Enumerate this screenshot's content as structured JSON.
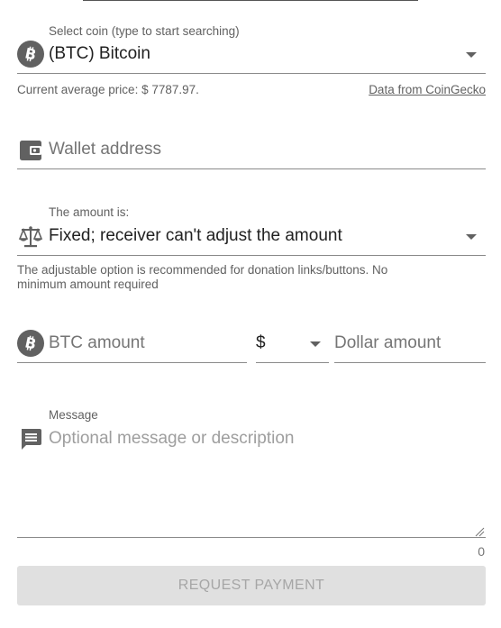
{
  "coin_select": {
    "label": "Select coin (type to start searching)",
    "value": "(BTC) Bitcoin",
    "icon": "bitcoin-icon"
  },
  "price_info": {
    "text": "Current average price: $ 7787.97.",
    "source_link": "Data from CoinGecko"
  },
  "wallet": {
    "placeholder": "Wallet address",
    "icon": "wallet-icon"
  },
  "amount_type": {
    "label": "The amount is:",
    "value": "Fixed; receiver can't adjust the amount",
    "icon": "scale-icon",
    "helper_line1": "The adjustable option is recommended for donation links/buttons. No",
    "helper_line2": "minimum amount required"
  },
  "amounts": {
    "coin_placeholder": "BTC amount",
    "coin_icon": "bitcoin-icon",
    "currency_value": "$",
    "fiat_placeholder": "Dollar amount"
  },
  "message": {
    "label": "Message",
    "placeholder": "Optional message or description",
    "icon": "message-icon",
    "char_count": "0"
  },
  "submit": {
    "label": "REQUEST PAYMENT"
  },
  "colors": {
    "icon_gray": "#616161",
    "button_bg": "#e0e0e0",
    "button_text": "#a6a6a6"
  }
}
